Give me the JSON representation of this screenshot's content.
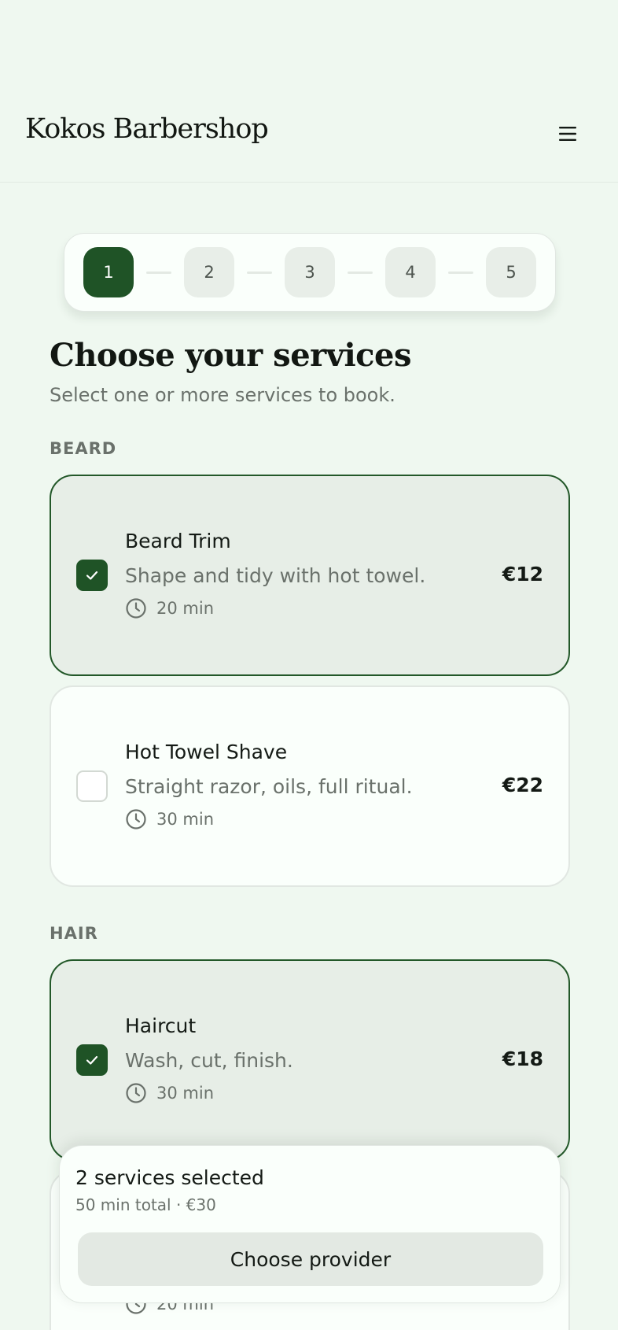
{
  "header": {
    "brand": "Kokos Barbershop",
    "menu_icon": "hamburger-menu-icon"
  },
  "stepper": {
    "steps": [
      "1",
      "2",
      "3",
      "4",
      "5"
    ],
    "active_step": 1
  },
  "main": {
    "title": "Choose your services",
    "subtitle": "Select one or more services to book."
  },
  "sections": [
    {
      "label": "BEARD",
      "services": [
        {
          "name": "Beard Trim",
          "description": "Shape and tidy with hot towel.",
          "duration": "20 min",
          "price": "€12",
          "selected": true
        },
        {
          "name": "Hot Towel Shave",
          "description": "Straight razor, oils, full ritual.",
          "duration": "30 min",
          "price": "€22",
          "selected": false
        }
      ]
    },
    {
      "label": "HAIR",
      "services": [
        {
          "name": "Haircut",
          "description": "Wash, cut, finish.",
          "duration": "30 min",
          "price": "€18",
          "selected": true
        },
        {
          "name": "",
          "description": "",
          "duration": "20 min",
          "price": "",
          "selected": false
        }
      ]
    }
  ],
  "summary": {
    "count": "2 services selected",
    "total": "50 min total · €30",
    "cta_label": "Choose provider"
  },
  "colors": {
    "accent": "#1f5326",
    "background": "#eff8f0",
    "card_selected_bg": "#e7eee7",
    "muted_text": "#6a716b"
  }
}
